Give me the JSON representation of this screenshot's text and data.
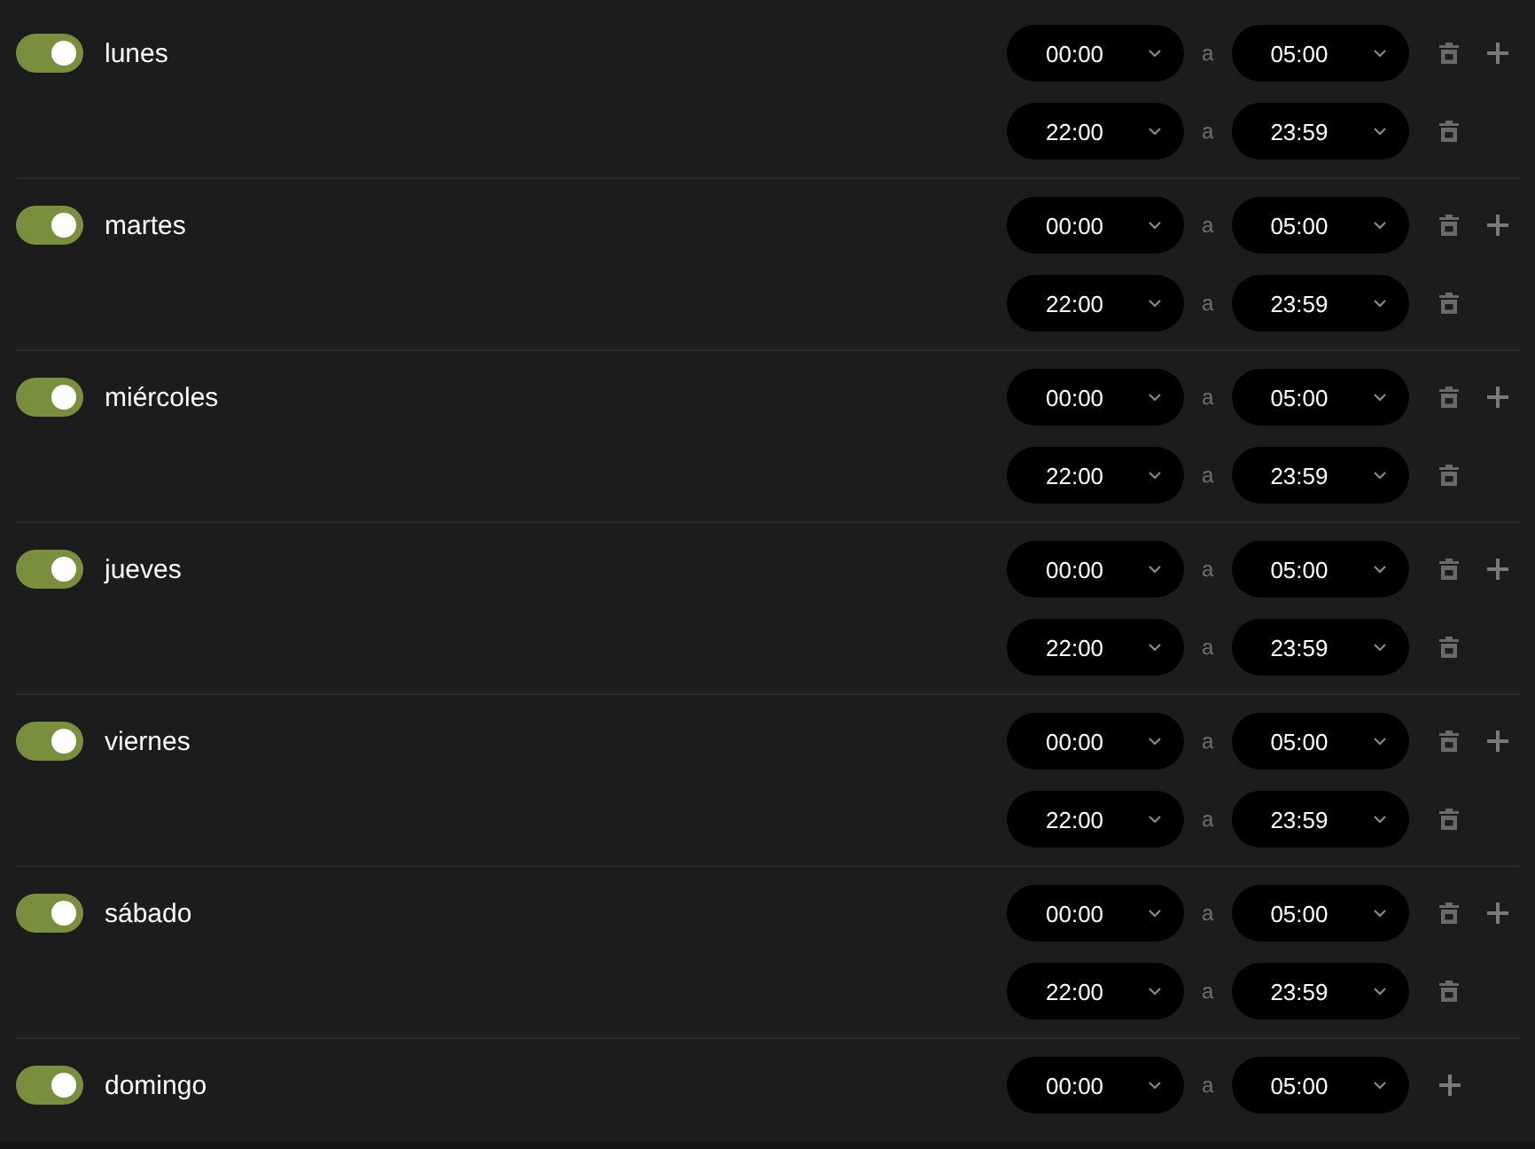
{
  "days": [
    {
      "name": "lunes",
      "on": true,
      "ranges": [
        {
          "start": "00:00",
          "separator": "a",
          "end": "05:00"
        },
        {
          "start": "22:00",
          "separator": "a",
          "end": "23:59"
        }
      ]
    },
    {
      "name": "martes",
      "on": true,
      "ranges": [
        {
          "start": "00:00",
          "separator": "a",
          "end": "05:00"
        },
        {
          "start": "22:00",
          "separator": "a",
          "end": "23:59"
        }
      ]
    },
    {
      "name": "miércoles",
      "on": true,
      "ranges": [
        {
          "start": "00:00",
          "separator": "a",
          "end": "05:00"
        },
        {
          "start": "22:00",
          "separator": "a",
          "end": "23:59"
        }
      ]
    },
    {
      "name": "jueves",
      "on": true,
      "ranges": [
        {
          "start": "00:00",
          "separator": "a",
          "end": "05:00"
        },
        {
          "start": "22:00",
          "separator": "a",
          "end": "23:59"
        }
      ]
    },
    {
      "name": "viernes",
      "on": true,
      "ranges": [
        {
          "start": "00:00",
          "separator": "a",
          "end": "05:00"
        },
        {
          "start": "22:00",
          "separator": "a",
          "end": "23:59"
        }
      ]
    },
    {
      "name": "sábado",
      "on": true,
      "ranges": [
        {
          "start": "00:00",
          "separator": "a",
          "end": "05:00"
        },
        {
          "start": "22:00",
          "separator": "a",
          "end": "23:59"
        }
      ]
    },
    {
      "name": "domingo",
      "on": true,
      "ranges": [
        {
          "start": "00:00",
          "separator": "a",
          "end": "05:00"
        }
      ]
    }
  ]
}
